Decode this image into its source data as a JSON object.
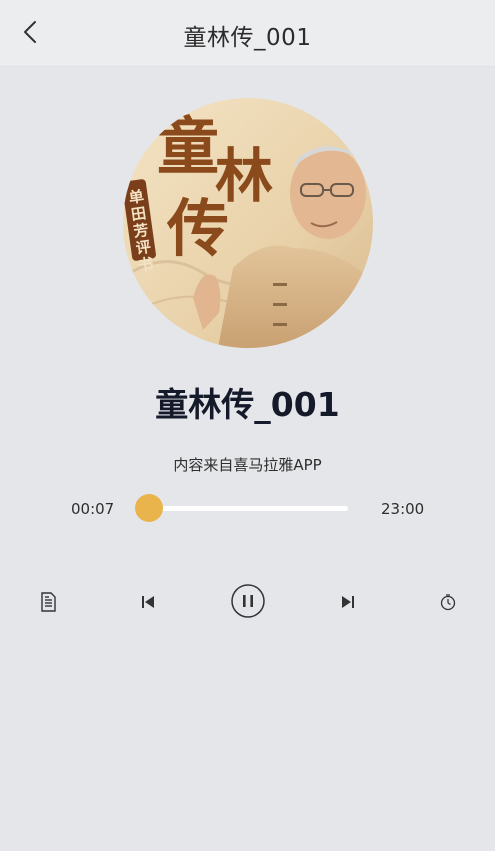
{
  "header": {
    "title": "童林传_001",
    "back_icon": "chevron-left-icon"
  },
  "cover": {
    "big_text": "童林传",
    "side_label": "单田芳评书",
    "accent_color": "#8a4a1c"
  },
  "track": {
    "title": "童林传_001",
    "source": "内容来自喜马拉雅APP"
  },
  "progress": {
    "current": "00:07",
    "total": "23:00",
    "fraction": 0.005,
    "color": "#e8b44b"
  },
  "controls": {
    "list_icon": "playlist-icon",
    "prev_icon": "skip-previous-icon",
    "play_icon": "pause-icon",
    "next_icon": "skip-next-icon",
    "timer_icon": "timer-icon"
  }
}
